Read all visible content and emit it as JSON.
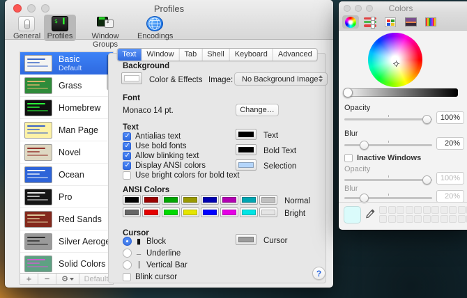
{
  "colors": {
    "accent_blue": "#3b78f7",
    "selection_blue": "#3875d7"
  },
  "profiles_window": {
    "title": "Profiles",
    "toolbar": {
      "items": [
        {
          "label": "General"
        },
        {
          "label": "Profiles"
        },
        {
          "label": "Window Groups"
        },
        {
          "label": "Encodings"
        }
      ]
    },
    "sidebar": {
      "items": [
        {
          "name": "Basic",
          "subtitle": "Default",
          "thumb_bg": "#f4f4f2",
          "thumb_line": "#3a66c6"
        },
        {
          "name": "Grass",
          "thumb_bg": "#2f8b3a",
          "thumb_line": "#d8b46a"
        },
        {
          "name": "Homebrew",
          "thumb_bg": "#101010",
          "thumb_line": "#29fe38"
        },
        {
          "name": "Man Page",
          "thumb_bg": "#fdf2a6",
          "thumb_line": "#3b62c8"
        },
        {
          "name": "Novel",
          "thumb_bg": "#ded8c2",
          "thumb_line": "#93332c"
        },
        {
          "name": "Ocean",
          "thumb_bg": "#2e64d8",
          "thumb_line": "#e8eef8"
        },
        {
          "name": "Pro",
          "thumb_bg": "#161616",
          "thumb_line": "#e8e8e8"
        },
        {
          "name": "Red Sands",
          "thumb_bg": "#84291d",
          "thumb_line": "#dcc69a"
        },
        {
          "name": "Silver Aerogel",
          "thumb_bg": "#9a9a9a",
          "thumb_line": "#2a2a2a"
        },
        {
          "name": "Solid Colors",
          "thumb_bg": "#5ea183",
          "thumb_line": "#cf5fd0"
        }
      ],
      "add_label": "+",
      "remove_label": "−",
      "gear_label": "⚙",
      "default_label": "Default"
    },
    "tabs": {
      "items": [
        {
          "label": "Text"
        },
        {
          "label": "Window"
        },
        {
          "label": "Tab"
        },
        {
          "label": "Shell"
        },
        {
          "label": "Keyboard"
        },
        {
          "label": "Advanced"
        }
      ],
      "selected": "Text"
    },
    "background": {
      "heading": "Background",
      "color_effects_label": "Color & Effects",
      "well_color": "#ffffff",
      "image_label": "Image:",
      "image_value": "No Background Image"
    },
    "font": {
      "heading": "Font",
      "current": "Monaco 14 pt.",
      "change_label": "Change…"
    },
    "text": {
      "heading": "Text",
      "options": [
        {
          "label": "Antialias text",
          "checked": true
        },
        {
          "label": "Use bold fonts",
          "checked": true
        },
        {
          "label": "Allow blinking text",
          "checked": true
        },
        {
          "label": "Display ANSI colors",
          "checked": true
        },
        {
          "label": "Use bright colors for bold text",
          "checked": false
        }
      ],
      "wells": [
        {
          "label": "Text",
          "color": "#000000"
        },
        {
          "label": "Bold Text",
          "color": "#000000"
        },
        {
          "label": "Selection",
          "color": "#b4d5fa"
        }
      ]
    },
    "ansi": {
      "heading": "ANSI Colors",
      "row_labels": [
        "Normal",
        "Bright"
      ],
      "normal": [
        "#000000",
        "#990000",
        "#00a600",
        "#999900",
        "#0000b2",
        "#b200b2",
        "#00a6b2",
        "#bfbfbf"
      ],
      "bright": [
        "#666666",
        "#e50000",
        "#00d900",
        "#e5e500",
        "#0000ff",
        "#e500e5",
        "#00e5e5",
        "#e5e5e5"
      ]
    },
    "cursor": {
      "heading": "Cursor",
      "options": [
        {
          "label": "Block",
          "glyph": "▮",
          "selected": true
        },
        {
          "label": "Underline",
          "glyph": "_",
          "selected": false
        },
        {
          "label": "Vertical Bar",
          "glyph": "|",
          "selected": false
        }
      ],
      "blink_label": "Blink cursor",
      "well_label": "Cursor",
      "well_color": "#9c9c9c"
    },
    "help_label": "?"
  },
  "colors_panel": {
    "title": "Colors",
    "opacity": {
      "label": "Opacity",
      "value": "100%"
    },
    "blur": {
      "label": "Blur",
      "value": "20%"
    },
    "inactive": {
      "label": "Inactive Windows",
      "opacity": {
        "label": "Opacity",
        "value": "100%"
      },
      "blur": {
        "label": "Blur",
        "value": "20%"
      }
    },
    "swatch_color": "#dafbfb"
  }
}
